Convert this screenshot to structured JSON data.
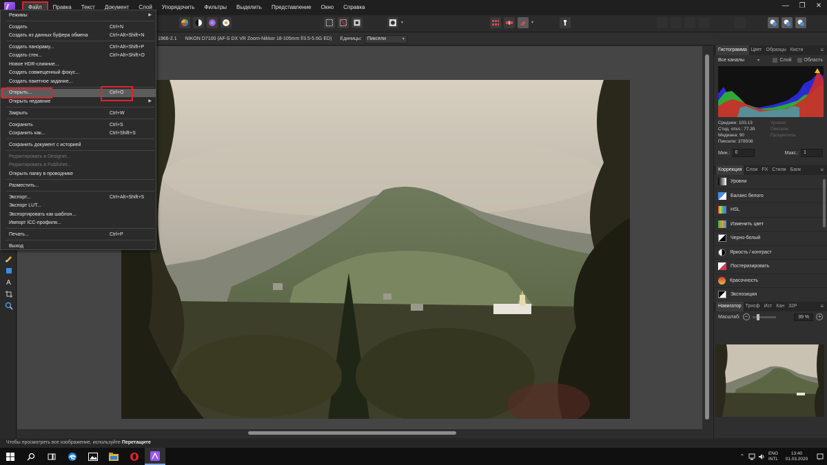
{
  "app": {
    "name": "Affinity Photo"
  },
  "menubar": {
    "items": [
      "Файл",
      "Правка",
      "Текст",
      "Документ",
      "Слой",
      "Упорядочить",
      "Фильтры",
      "Выделить",
      "Представление",
      "Окно",
      "Справка"
    ],
    "active": "Файл"
  },
  "context": {
    "camera_id": "1966-2.1",
    "camera": "NIKON D7100 (AF-S DX VR Zoom-Nikkor 18-105mm f/3.5-5.6G ED)",
    "units_label": "Единицы:",
    "units_value": "Пиксели"
  },
  "file_menu": {
    "items": [
      {
        "label": "Режимы",
        "shortcut": "",
        "submenu": true
      },
      {
        "label": "Создать",
        "shortcut": "Ctrl+N"
      },
      {
        "label": "Создать из данных буфера обмена",
        "shortcut": "Ctrl+Alt+Shift+N"
      },
      {
        "label": "Создать панораму...",
        "shortcut": "Ctrl+Alt+Shift+P"
      },
      {
        "label": "Создать стек...",
        "shortcut": "Ctrl+Alt+Shift+O"
      },
      {
        "label": "Новое HDR-слияние...",
        "shortcut": ""
      },
      {
        "label": "Создать совмещенный фокус...",
        "shortcut": ""
      },
      {
        "label": "Создать пакетное задание...",
        "shortcut": ""
      },
      {
        "label": "Открыть...",
        "shortcut": "Ctrl+O",
        "highlight": true
      },
      {
        "label": "Открыть недавние",
        "shortcut": "",
        "submenu": true
      },
      {
        "label": "Закрыть",
        "shortcut": "Ctrl+W"
      },
      {
        "label": "Сохранить",
        "shortcut": "Ctrl+S"
      },
      {
        "label": "Сохранить как...",
        "shortcut": "Ctrl+Shift+S"
      },
      {
        "label": "Сохранить документ с историей",
        "shortcut": ""
      },
      {
        "label": "Редактировать в Designer...",
        "shortcut": "",
        "disabled": true
      },
      {
        "label": "Редактировать в Publisher...",
        "shortcut": "",
        "disabled": true
      },
      {
        "label": "Открыть папку в проводнике",
        "shortcut": ""
      },
      {
        "label": "Разместить...",
        "shortcut": ""
      },
      {
        "label": "Экспорт...",
        "shortcut": "Ctrl+Alt+Shift+S"
      },
      {
        "label": "Экспорт LUT...",
        "shortcut": ""
      },
      {
        "label": "Экспортировать как шаблон...",
        "shortcut": ""
      },
      {
        "label": "Импорт ICC-профиля...",
        "shortcut": ""
      },
      {
        "label": "Печать...",
        "shortcut": "Ctrl+P"
      },
      {
        "label": "Выход",
        "shortcut": ""
      }
    ]
  },
  "status": {
    "text": "Чтобы просмотреть все изображение, используйте",
    "bold": "Перетащите"
  },
  "histogram_panel": {
    "tabs": [
      "Гистограмма",
      "Цвет",
      "Образцы",
      "Кисти"
    ],
    "channel": "Все каналы",
    "layer_label": "Слой",
    "area_label": "Область",
    "stats": [
      "Среднее: 103.13",
      "Стнд. откл.: 77.39",
      "Медиана: 90",
      "Пиксели: 378508"
    ],
    "stats_dim": [
      "Уровни:",
      "Пиксели:",
      "Процентиль:"
    ],
    "min_label": "Мин.:",
    "min_value": "0",
    "max_label": "Макс.:",
    "max_value": "1"
  },
  "adjustment_panel": {
    "tabs": [
      "Коррекция",
      "Слои",
      "FX",
      "Стили",
      "Банк"
    ],
    "items": [
      "Уровни",
      "Баланс белого",
      "HSL",
      "Изменить цвет",
      "Черно-белый",
      "Яркость / контраст",
      "Постеризировать",
      "Красочность",
      "Экспозиция"
    ]
  },
  "navigator_panel": {
    "tabs": [
      "Навигатор",
      "Трнсф",
      "Ист",
      "Кан",
      "32P"
    ],
    "zoom_label": "Масштаб:",
    "zoom_value": "39 %"
  },
  "taskbar": {
    "lang": "ENG",
    "layout": "INTL",
    "time": "13:40",
    "date": "01.03.2020"
  }
}
